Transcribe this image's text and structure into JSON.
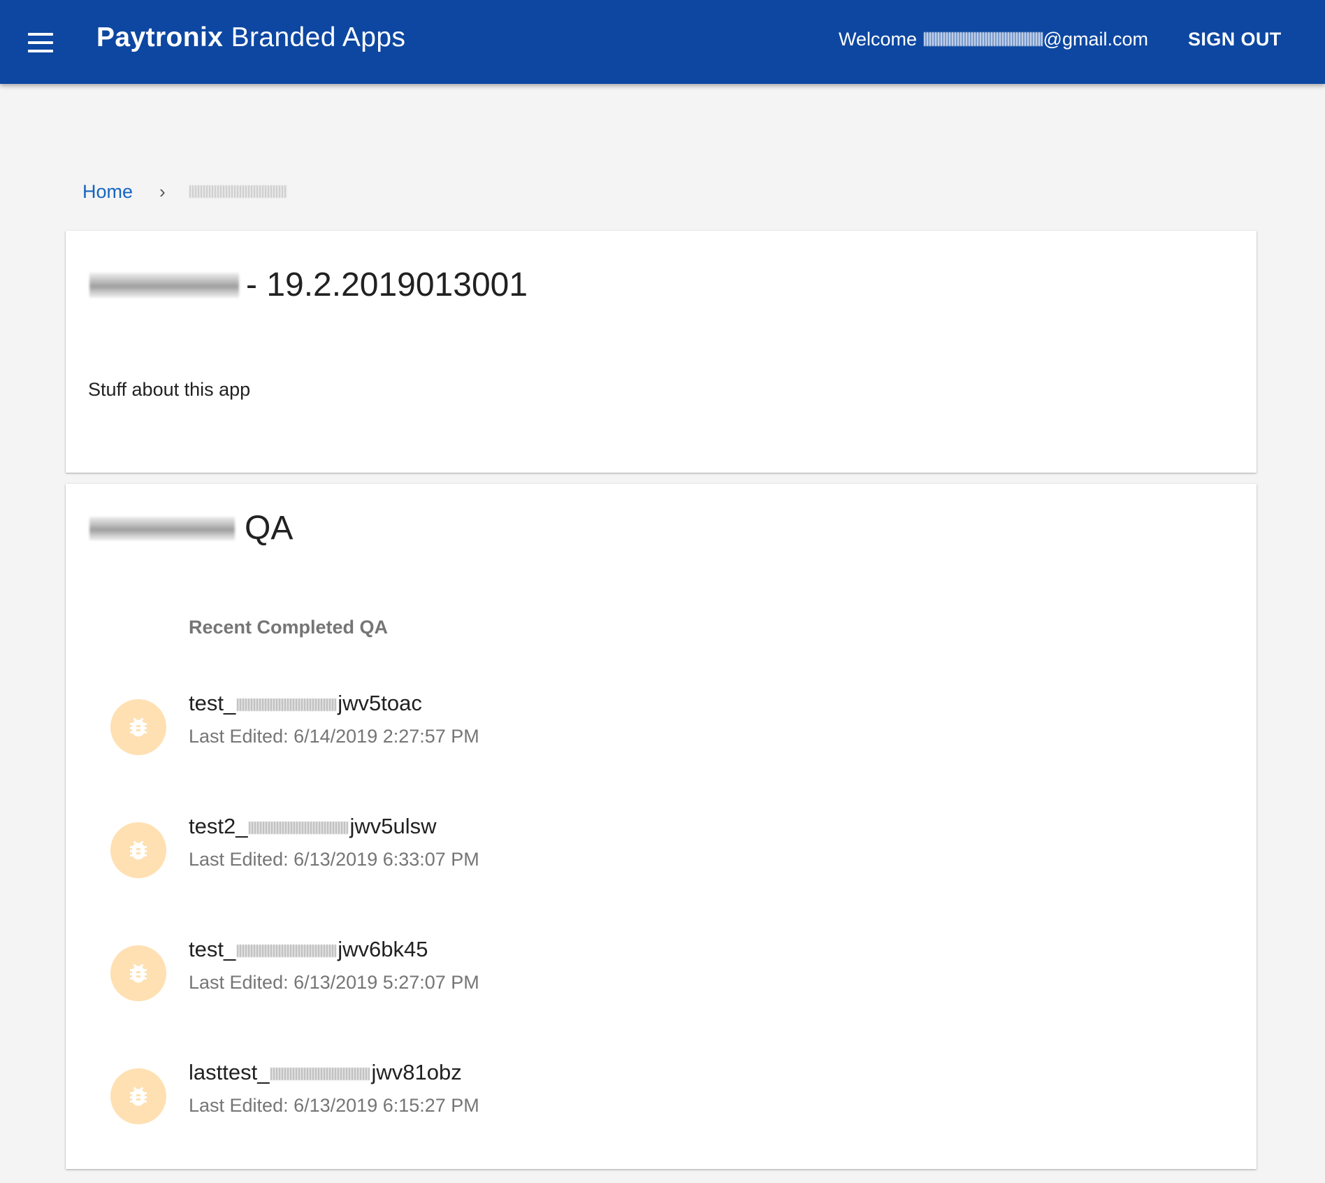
{
  "appbar": {
    "title_brand": "Paytronix",
    "title_rest": " Branded Apps",
    "welcome_prefix": "Welcome ",
    "welcome_email_suffix": "@gmail.com",
    "sign_out": "SIGN OUT",
    "color": "#0d47a1"
  },
  "breadcrumb": {
    "home": "Home",
    "separator": "›"
  },
  "app_card": {
    "version": "- 19.2.2019013001",
    "description": "Stuff about this app"
  },
  "qa_card": {
    "title_suffix": "QA",
    "subheader": "Recent Completed QA",
    "items": [
      {
        "prefix": "test_",
        "suffix": "jwv5toac",
        "edited": "Last Edited: 6/14/2019 2:27:57 PM",
        "icon": "bug-icon"
      },
      {
        "prefix": "test2_",
        "suffix": "jwv5ulsw",
        "edited": "Last Edited: 6/13/2019 6:33:07 PM",
        "icon": "bug-icon"
      },
      {
        "prefix": "test_",
        "suffix": "jwv6bk45",
        "edited": "Last Edited: 6/13/2019 5:27:07 PM",
        "icon": "bug-icon"
      },
      {
        "prefix": "lasttest_",
        "suffix": "jwv81obz",
        "edited": "Last Edited: 6/13/2019 6:15:27 PM",
        "icon": "bug-icon"
      }
    ],
    "avatar_color": "#ffe0b2"
  }
}
